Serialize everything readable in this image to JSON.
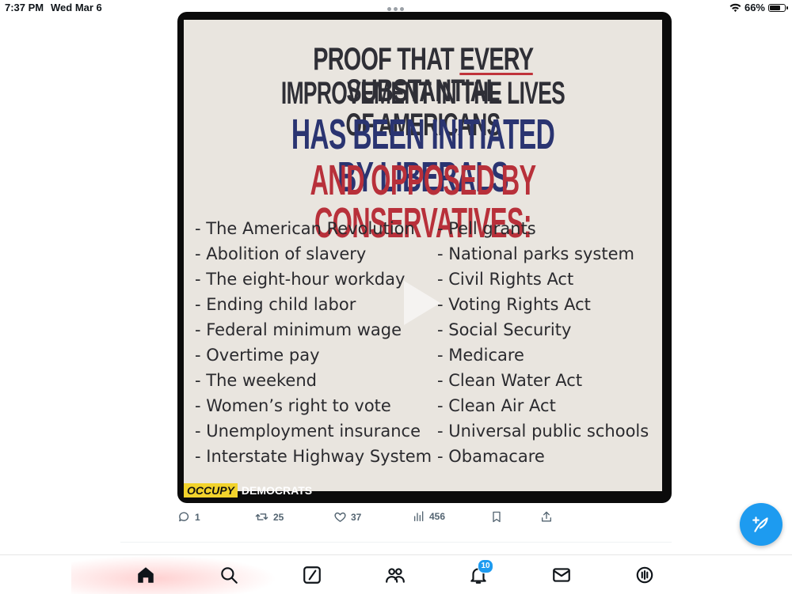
{
  "status_bar": {
    "time": "7:37 PM",
    "date": "Wed Mar 6",
    "battery": "66%",
    "battery_level": 0.66
  },
  "post": {
    "image": {
      "headline": {
        "line1_pre": "PROOF THAT ",
        "line1_underlined": "EVERY",
        "line1_post": " SUBSTANTIAL",
        "line2": "IMPROVEMENT IN THE LIVES OF AMERICANS",
        "line3": "HAS BEEN INITIATED BY LIBERALS",
        "line4": "AND OPPOSED BY CONSERVATIVES:"
      },
      "left_items": [
        "- The American Revolution",
        "- Abolition of slavery",
        "- The eight-hour workday",
        "- Ending child labor",
        "- Federal minimum wage",
        "- Overtime pay",
        "- The weekend",
        "- Women’s right to vote",
        "- Unemployment insurance",
        "- Interstate Highway System"
      ],
      "right_items": [
        "- Pell grants",
        "- National parks system",
        "- Civil Rights Act",
        "- Voting Rights Act",
        "- Social Security",
        "- Medicare",
        "- Clean Water Act",
        "- Clean Air Act",
        "- Universal public schools",
        "- Obamacare"
      ],
      "brand_occupy": "OCCUPY",
      "brand_democrats": "DEMOCRATS"
    },
    "actions": {
      "replies": "1",
      "reposts": "25",
      "likes": "37",
      "views": "456"
    }
  },
  "tab_bar": {
    "notifications_badge": "10",
    "icons": [
      "home-icon",
      "search-icon",
      "grok-icon",
      "communities-icon",
      "notifications-icon",
      "messages-icon",
      "spaces-icon"
    ]
  },
  "colors": {
    "accent": "#1d9bf0",
    "headline_blue": "#2a3471",
    "headline_red": "#b8303a",
    "brand_yellow": "#f2d32c"
  }
}
